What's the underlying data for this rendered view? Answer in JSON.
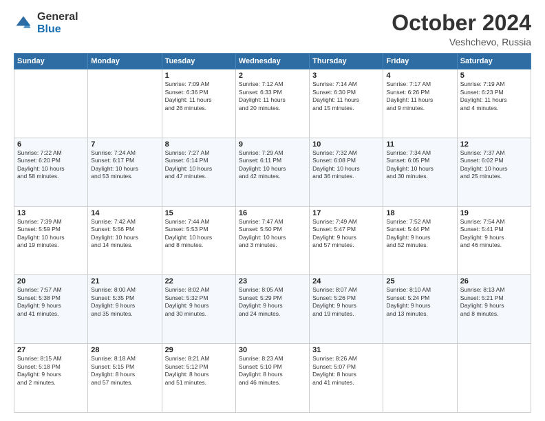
{
  "logo": {
    "general": "General",
    "blue": "Blue"
  },
  "header": {
    "month": "October 2024",
    "location": "Veshchevo, Russia"
  },
  "weekdays": [
    "Sunday",
    "Monday",
    "Tuesday",
    "Wednesday",
    "Thursday",
    "Friday",
    "Saturday"
  ],
  "weeks": [
    [
      {
        "day": "",
        "info": ""
      },
      {
        "day": "",
        "info": ""
      },
      {
        "day": "1",
        "info": "Sunrise: 7:09 AM\nSunset: 6:36 PM\nDaylight: 11 hours\nand 26 minutes."
      },
      {
        "day": "2",
        "info": "Sunrise: 7:12 AM\nSunset: 6:33 PM\nDaylight: 11 hours\nand 20 minutes."
      },
      {
        "day": "3",
        "info": "Sunrise: 7:14 AM\nSunset: 6:30 PM\nDaylight: 11 hours\nand 15 minutes."
      },
      {
        "day": "4",
        "info": "Sunrise: 7:17 AM\nSunset: 6:26 PM\nDaylight: 11 hours\nand 9 minutes."
      },
      {
        "day": "5",
        "info": "Sunrise: 7:19 AM\nSunset: 6:23 PM\nDaylight: 11 hours\nand 4 minutes."
      }
    ],
    [
      {
        "day": "6",
        "info": "Sunrise: 7:22 AM\nSunset: 6:20 PM\nDaylight: 10 hours\nand 58 minutes."
      },
      {
        "day": "7",
        "info": "Sunrise: 7:24 AM\nSunset: 6:17 PM\nDaylight: 10 hours\nand 53 minutes."
      },
      {
        "day": "8",
        "info": "Sunrise: 7:27 AM\nSunset: 6:14 PM\nDaylight: 10 hours\nand 47 minutes."
      },
      {
        "day": "9",
        "info": "Sunrise: 7:29 AM\nSunset: 6:11 PM\nDaylight: 10 hours\nand 42 minutes."
      },
      {
        "day": "10",
        "info": "Sunrise: 7:32 AM\nSunset: 6:08 PM\nDaylight: 10 hours\nand 36 minutes."
      },
      {
        "day": "11",
        "info": "Sunrise: 7:34 AM\nSunset: 6:05 PM\nDaylight: 10 hours\nand 30 minutes."
      },
      {
        "day": "12",
        "info": "Sunrise: 7:37 AM\nSunset: 6:02 PM\nDaylight: 10 hours\nand 25 minutes."
      }
    ],
    [
      {
        "day": "13",
        "info": "Sunrise: 7:39 AM\nSunset: 5:59 PM\nDaylight: 10 hours\nand 19 minutes."
      },
      {
        "day": "14",
        "info": "Sunrise: 7:42 AM\nSunset: 5:56 PM\nDaylight: 10 hours\nand 14 minutes."
      },
      {
        "day": "15",
        "info": "Sunrise: 7:44 AM\nSunset: 5:53 PM\nDaylight: 10 hours\nand 8 minutes."
      },
      {
        "day": "16",
        "info": "Sunrise: 7:47 AM\nSunset: 5:50 PM\nDaylight: 10 hours\nand 3 minutes."
      },
      {
        "day": "17",
        "info": "Sunrise: 7:49 AM\nSunset: 5:47 PM\nDaylight: 9 hours\nand 57 minutes."
      },
      {
        "day": "18",
        "info": "Sunrise: 7:52 AM\nSunset: 5:44 PM\nDaylight: 9 hours\nand 52 minutes."
      },
      {
        "day": "19",
        "info": "Sunrise: 7:54 AM\nSunset: 5:41 PM\nDaylight: 9 hours\nand 46 minutes."
      }
    ],
    [
      {
        "day": "20",
        "info": "Sunrise: 7:57 AM\nSunset: 5:38 PM\nDaylight: 9 hours\nand 41 minutes."
      },
      {
        "day": "21",
        "info": "Sunrise: 8:00 AM\nSunset: 5:35 PM\nDaylight: 9 hours\nand 35 minutes."
      },
      {
        "day": "22",
        "info": "Sunrise: 8:02 AM\nSunset: 5:32 PM\nDaylight: 9 hours\nand 30 minutes."
      },
      {
        "day": "23",
        "info": "Sunrise: 8:05 AM\nSunset: 5:29 PM\nDaylight: 9 hours\nand 24 minutes."
      },
      {
        "day": "24",
        "info": "Sunrise: 8:07 AM\nSunset: 5:26 PM\nDaylight: 9 hours\nand 19 minutes."
      },
      {
        "day": "25",
        "info": "Sunrise: 8:10 AM\nSunset: 5:24 PM\nDaylight: 9 hours\nand 13 minutes."
      },
      {
        "day": "26",
        "info": "Sunrise: 8:13 AM\nSunset: 5:21 PM\nDaylight: 9 hours\nand 8 minutes."
      }
    ],
    [
      {
        "day": "27",
        "info": "Sunrise: 8:15 AM\nSunset: 5:18 PM\nDaylight: 9 hours\nand 2 minutes."
      },
      {
        "day": "28",
        "info": "Sunrise: 8:18 AM\nSunset: 5:15 PM\nDaylight: 8 hours\nand 57 minutes."
      },
      {
        "day": "29",
        "info": "Sunrise: 8:21 AM\nSunset: 5:12 PM\nDaylight: 8 hours\nand 51 minutes."
      },
      {
        "day": "30",
        "info": "Sunrise: 8:23 AM\nSunset: 5:10 PM\nDaylight: 8 hours\nand 46 minutes."
      },
      {
        "day": "31",
        "info": "Sunrise: 8:26 AM\nSunset: 5:07 PM\nDaylight: 8 hours\nand 41 minutes."
      },
      {
        "day": "",
        "info": ""
      },
      {
        "day": "",
        "info": ""
      }
    ]
  ]
}
